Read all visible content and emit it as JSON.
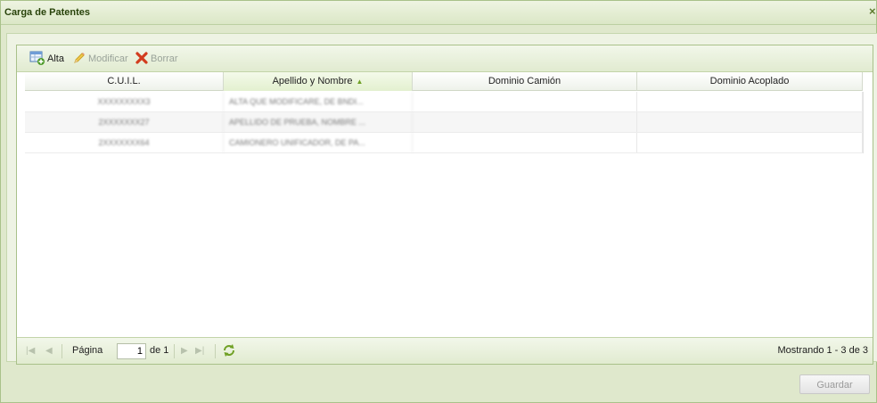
{
  "window": {
    "title": "Carga de Patentes",
    "close_glyph": "×"
  },
  "toolbar": {
    "alta": {
      "label": "Alta",
      "icon": "add-table-icon"
    },
    "modificar": {
      "label": "Modificar",
      "icon": "pencil-icon"
    },
    "borrar": {
      "label": "Borrar",
      "icon": "red-x-icon"
    }
  },
  "grid": {
    "columns": [
      "C.U.I.L.",
      "Apellido y Nombre",
      "Dominio Camión",
      "Dominio Acoplado"
    ],
    "sort_arrow": "▲",
    "rows": [
      {
        "cuil": "XXXXXXXXX3",
        "nombre": "ALTA QUE MODIFICARE, DE BNDI...",
        "camion": "",
        "acoplado": ""
      },
      {
        "cuil": "2XXXXXXX27",
        "nombre": "APELLIDO DE PRUEBA, NOMBRE ...",
        "camion": "",
        "acoplado": ""
      },
      {
        "cuil": "2XXXXXXX64",
        "nombre": "CAMIONERO UNIFICADOR, DE PA...",
        "camion": "",
        "acoplado": ""
      }
    ]
  },
  "paging": {
    "page_label": "Página",
    "page_value": "1",
    "of_label": "de 1",
    "status": "Mostrando 1 - 3 de 3"
  },
  "footer": {
    "save_label": "Guardar"
  },
  "colors": {
    "accent": "#a9c18a",
    "title": "#28430a",
    "refresh": "#6fa024",
    "delete": "#d23c1e"
  }
}
